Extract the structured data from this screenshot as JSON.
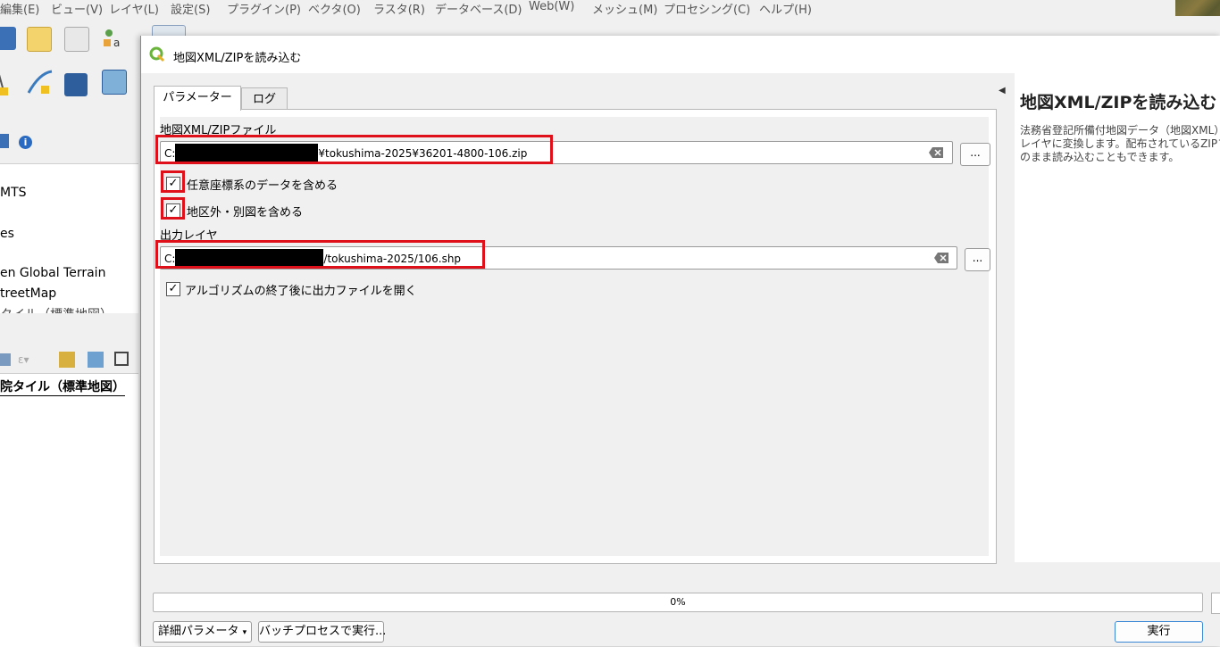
{
  "menu": [
    "編集(E)",
    "ビュー(V)",
    "レイヤ(L)",
    "設定(S)",
    "プラグイン(P)",
    "ベクタ(O)",
    "ラスタ(R)",
    "データベース(D)",
    "Web(W)",
    "メッシュ(M)",
    "プロセシング(C)",
    "ヘルプ(H)"
  ],
  "layers": [
    "MTS",
    "es",
    "en Global Terrain",
    "treetMap",
    "タイル（標準地図）"
  ],
  "browser_item": "院タイル（標準地図）",
  "dialog": {
    "title": "地図XML/ZIPを読み込む",
    "tabs": {
      "params": "パラメーター",
      "log": "ログ"
    },
    "input_label": "地図XML/ZIPファイル",
    "input_prefix": "C:",
    "input_suffix": "¥tokushima-2025¥36201-4800-106.zip",
    "browse_label": "...",
    "opt_any_crs": {
      "label": "任意座標系のデータを含める",
      "checked": true
    },
    "opt_outside": {
      "label": "地区外・別図を含める",
      "checked": true
    },
    "output_label": "出力レイヤ",
    "output_prefix": "C:",
    "output_suffix": "/tokushima-2025/106.shp",
    "output_browse_label": "...",
    "open_after": {
      "label": "アルゴリズムの終了後に出力ファイルを開く",
      "checked": true
    },
    "help_title": "地図XML/ZIPを読み込む",
    "help_lines": [
      "法務省登記所備付地図データ（地図XML）を",
      "レイヤに変換します。配布されているZIPファイル",
      "のまま読み込むこともできます。"
    ],
    "progress": "0%",
    "progress_value": 0,
    "advanced_label": "詳細パラメータ",
    "batch_label": "バッチプロセスで実行...",
    "run_label": "実行"
  },
  "colors": {
    "highlight_red": "#e0101a",
    "run_border": "#3a87d6"
  }
}
